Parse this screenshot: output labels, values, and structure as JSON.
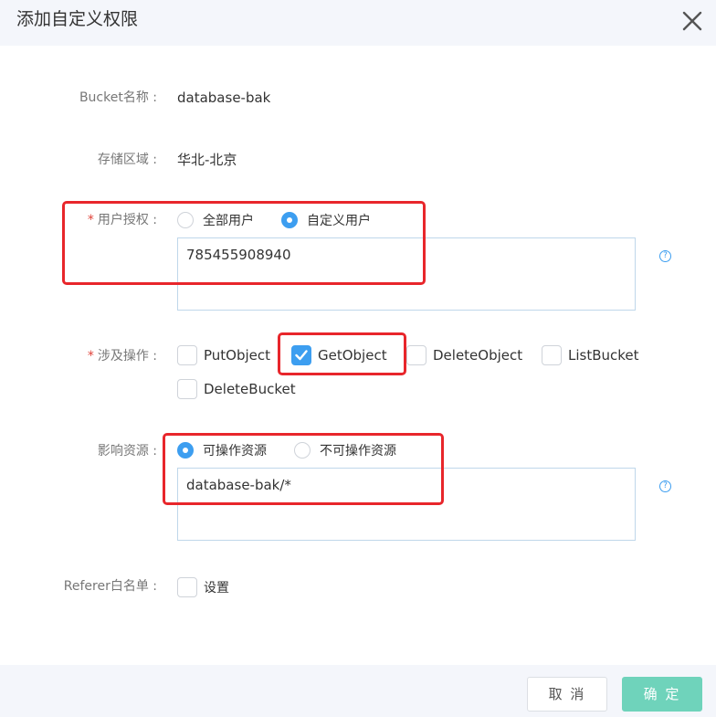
{
  "dialog": {
    "title": "添加自定义权限"
  },
  "fields": {
    "bucket_name": {
      "label": "Bucket名称 :",
      "value": "database-bak"
    },
    "storage_region": {
      "label": "存储区域 :",
      "value": "华北-北京"
    },
    "user_auth": {
      "required_mark": "*",
      "label": "用户授权 :",
      "options": [
        "全部用户",
        "自定义用户"
      ],
      "selected": "自定义用户",
      "textarea_value": "785455908940"
    },
    "operations": {
      "required_mark": "*",
      "label": "涉及操作 :",
      "options": [
        {
          "label": "PutObject",
          "checked": false
        },
        {
          "label": "GetObject",
          "checked": true
        },
        {
          "label": "DeleteObject",
          "checked": false
        },
        {
          "label": "ListBucket",
          "checked": false
        },
        {
          "label": "DeleteBucket",
          "checked": false
        }
      ]
    },
    "resources": {
      "label": "影响资源 :",
      "options": [
        "可操作资源",
        "不可操作资源"
      ],
      "selected": "可操作资源",
      "textarea_value": "database-bak/*"
    },
    "referer": {
      "label": "Referer白名单 :",
      "checkbox_label": "设置",
      "checked": false
    }
  },
  "help_icon": "?",
  "footer": {
    "cancel_label": "取 消",
    "confirm_label": "确 定"
  },
  "colors": {
    "accent": "#3d9ef0",
    "confirm": "#6fd3bb",
    "highlight": "#e8262b",
    "required": "#e0433a"
  }
}
